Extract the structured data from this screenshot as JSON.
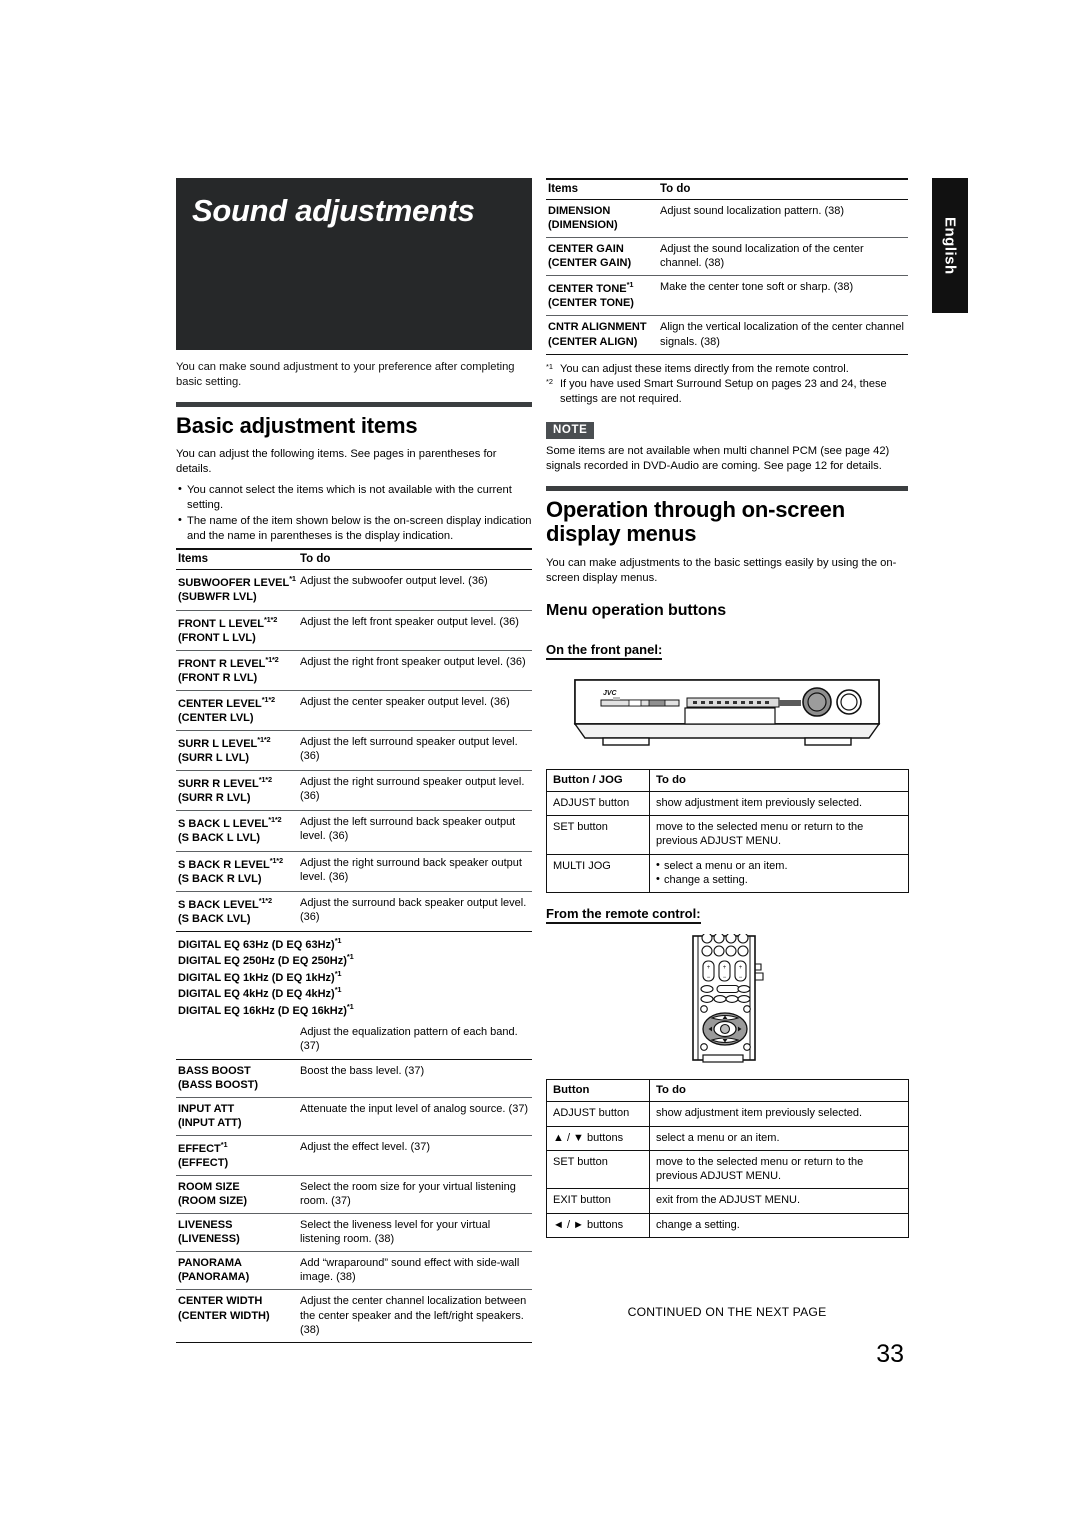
{
  "page": {
    "language_tab": "English",
    "chapter_title": "Sound adjustments",
    "intro": "You can make sound adjustment to your preference after completing basic setting.",
    "continued_note": "CONTINUED ON THE NEXT PAGE",
    "page_number": "33"
  },
  "basic_adjustment": {
    "heading": "Basic adjustment items",
    "intro": "You can adjust the following items. See pages in parentheses for details.",
    "bullets": [
      "You cannot select the items which is not available with the current setting.",
      "The name of the item shown below is the on-screen display indication and the name in parentheses is the display indication."
    ],
    "table": {
      "headers": [
        "Items",
        "To do"
      ],
      "rows": [
        {
          "item": "SUBWOOFER LEVEL",
          "sup": "*1",
          "alias": "(SUBWFR LVL)",
          "todo": "Adjust the subwoofer output level. (36)"
        },
        {
          "item": "FRONT L LEVEL",
          "sup": "*1*2",
          "alias": "(FRONT L LVL)",
          "todo": "Adjust the left front speaker output level. (36)"
        },
        {
          "item": "FRONT R LEVEL",
          "sup": "*1*2",
          "alias": "(FRONT R LVL)",
          "todo": "Adjust the right front speaker output level. (36)"
        },
        {
          "item": "CENTER LEVEL",
          "sup": "*1*2",
          "alias": "(CENTER LVL)",
          "todo": "Adjust the center speaker output level. (36)"
        },
        {
          "item": "SURR L LEVEL",
          "sup": "*1*2",
          "alias": "(SURR L LVL)",
          "todo": "Adjust the left surround speaker output level. (36)"
        },
        {
          "item": "SURR R LEVEL",
          "sup": "*1*2",
          "alias": "(SURR R LVL)",
          "todo": "Adjust the right surround speaker output level. (36)"
        },
        {
          "item": "S BACK L LEVEL",
          "sup": "*1*2",
          "alias": "(S BACK L LVL)",
          "todo": "Adjust the left surround back speaker output level. (36)"
        },
        {
          "item": "S BACK R LEVEL",
          "sup": "*1*2",
          "alias": "(S BACK R LVL)",
          "todo": "Adjust the right surround back speaker output level. (36)"
        },
        {
          "item": "S BACK LEVEL",
          "sup": "*1*2",
          "alias": "(S BACK LVL)",
          "todo": "Adjust the surround back speaker output level. (36)"
        }
      ],
      "eq_block": {
        "lines": [
          {
            "text": "DIGITAL EQ 63Hz (D EQ 63Hz)",
            "sup": "*1"
          },
          {
            "text": "DIGITAL EQ 250Hz (D EQ 250Hz)",
            "sup": "*1"
          },
          {
            "text": "DIGITAL EQ 1kHz (D EQ 1kHz)",
            "sup": "*1"
          },
          {
            "text": "DIGITAL EQ 4kHz (D EQ 4kHz)",
            "sup": "*1"
          },
          {
            "text": "DIGITAL EQ 16kHz (D EQ 16kHz)",
            "sup": "*1"
          }
        ],
        "todo": "Adjust the equalization pattern of each band. (37)"
      },
      "rows_after": [
        {
          "item": "BASS BOOST",
          "sup": "",
          "alias": "(BASS BOOST)",
          "todo": "Boost the bass level. (37)"
        },
        {
          "item": "INPUT ATT",
          "sup": "",
          "alias": "(INPUT ATT)",
          "todo": "Attenuate the input level of analog source. (37)"
        },
        {
          "item": "EFFECT",
          "sup": "*1",
          "alias": "(EFFECT)",
          "todo": "Adjust the effect level. (37)"
        },
        {
          "item": "ROOM SIZE",
          "sup": "",
          "alias": "(ROOM SIZE)",
          "todo": "Select the room size for your virtual listening room. (37)"
        },
        {
          "item": "LIVENESS",
          "sup": "",
          "alias": "(LIVENESS)",
          "todo": "Select the liveness level for your virtual listening room. (38)"
        },
        {
          "item": "PANORAMA",
          "sup": "",
          "alias": "(PANORAMA)",
          "todo": "Add “wraparound” sound effect with side-wall image. (38)"
        },
        {
          "item": "CENTER WIDTH",
          "sup": "",
          "alias": "(CENTER WIDTH)",
          "todo": "Adjust the center channel localization between the center speaker and the left/right speakers. (38)"
        }
      ]
    }
  },
  "right_table": {
    "headers": [
      "Items",
      "To do"
    ],
    "rows": [
      {
        "item": "DIMENSION",
        "sup": "",
        "alias": "(DIMENSION)",
        "todo": "Adjust sound localization pattern. (38)"
      },
      {
        "item": "CENTER GAIN",
        "sup": "",
        "alias": "(CENTER GAIN)",
        "todo": "Adjust the sound localization of the center channel. (38)"
      },
      {
        "item": "CENTER TONE",
        "sup": "*1",
        "alias": "(CENTER TONE)",
        "todo": "Make the center tone soft or sharp. (38)"
      },
      {
        "item": "CNTR ALIGNMENT",
        "sup": "",
        "alias": "(CENTER ALIGN)",
        "todo": "Align the vertical localization of the center channel signals. (38)"
      }
    ],
    "footnotes": [
      {
        "mark": "*1",
        "text": "You can adjust these items directly from the remote control."
      },
      {
        "mark": "*2",
        "text": "If you have used Smart Surround Setup on pages 23 and 24, these settings are not required."
      }
    ],
    "note_badge": "NOTE",
    "note_text": "Some items are not available when multi channel PCM (see page 42) signals recorded in DVD-Audio are coming. See page 12 for details."
  },
  "osd_section": {
    "heading": "Operation through on-screen display menus",
    "intro": "You can make adjustments to the basic settings easily by using the on-screen display menus.",
    "sub_heading": "Menu operation buttons",
    "front_panel_label": "On the front panel:",
    "front_panel_brand": "JVC",
    "remote_label": "From the remote control:",
    "front_panel_table": {
      "headers": [
        "Button / JOG",
        "To do"
      ],
      "rows": [
        {
          "button": "ADJUST button",
          "todo": "show adjustment item previously selected.",
          "list": null
        },
        {
          "button": "SET button",
          "todo": "move to the selected menu or return to the previous ADJUST MENU.",
          "list": null
        },
        {
          "button": "MULTI JOG",
          "todo": "",
          "list": [
            "select a menu or an item.",
            "change a setting."
          ]
        }
      ]
    },
    "remote_table": {
      "headers": [
        "Button",
        "To do"
      ],
      "rows": [
        {
          "button": "ADJUST button",
          "todo": "show adjustment item previously selected."
        },
        {
          "button": "▲ / ▼ buttons",
          "todo": "select a menu or an item."
        },
        {
          "button": "SET button",
          "todo": "move to the selected menu or return to the previous ADJUST MENU."
        },
        {
          "button": "EXIT button",
          "todo": "exit from the ADJUST MENU."
        },
        {
          "button": "◄ / ► buttons",
          "todo": "change a setting."
        }
      ]
    }
  }
}
